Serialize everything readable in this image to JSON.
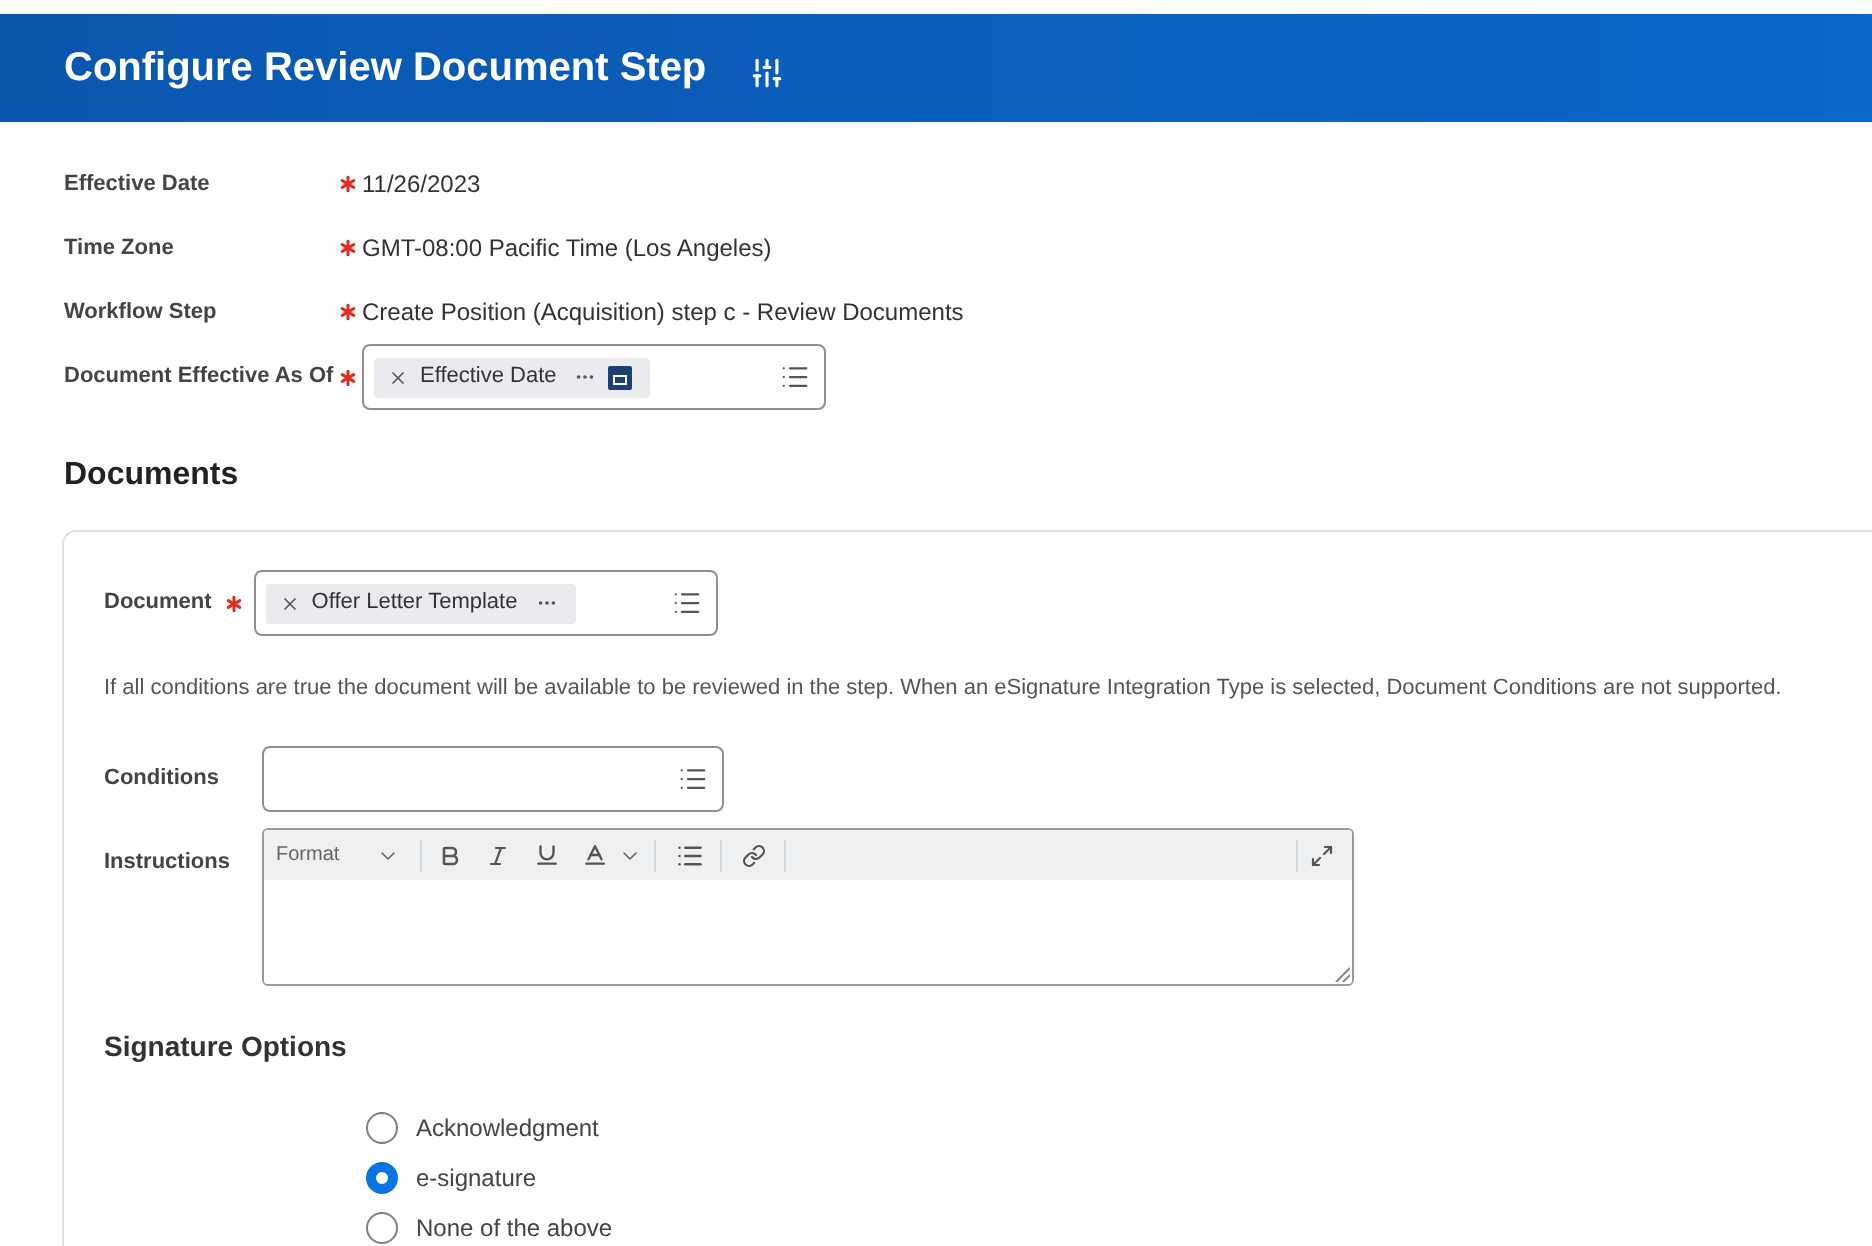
{
  "header": {
    "title": "Configure Review Document Step"
  },
  "fields": [
    {
      "label": "Effective Date",
      "required": true,
      "kind": "text",
      "value": "11/26/2023"
    },
    {
      "label": "Time Zone",
      "required": true,
      "kind": "text",
      "value": "GMT-08:00 Pacific Time (Los Angeles)"
    },
    {
      "label": "Workflow Step",
      "required": true,
      "kind": "text",
      "value": "Create Position (Acquisition) step c - Review Documents"
    },
    {
      "label": "Document Effective As Of",
      "required": true,
      "kind": "prompt",
      "tokens": [
        {
          "label": "Effective Date",
          "kind": "date"
        }
      ]
    }
  ],
  "documents": {
    "heading": "Documents",
    "document": {
      "label": "Document",
      "required": true,
      "tokens": [
        {
          "label": "Offer Letter Template",
          "kind": "item"
        }
      ]
    },
    "help_text": "If all conditions are true the document will be available to be reviewed in the step. When an eSignature Integration Type is selected, Document Conditions are not supported.",
    "conditions": {
      "label": "Conditions"
    },
    "instructions": {
      "label": "Instructions",
      "format_label": "Format"
    },
    "signature_options": {
      "heading": "Signature Options",
      "options": [
        {
          "label": "Acknowledgment",
          "selected": false
        },
        {
          "label": "e-signature",
          "selected": true
        },
        {
          "label": "None of the above",
          "selected": false
        }
      ]
    }
  }
}
